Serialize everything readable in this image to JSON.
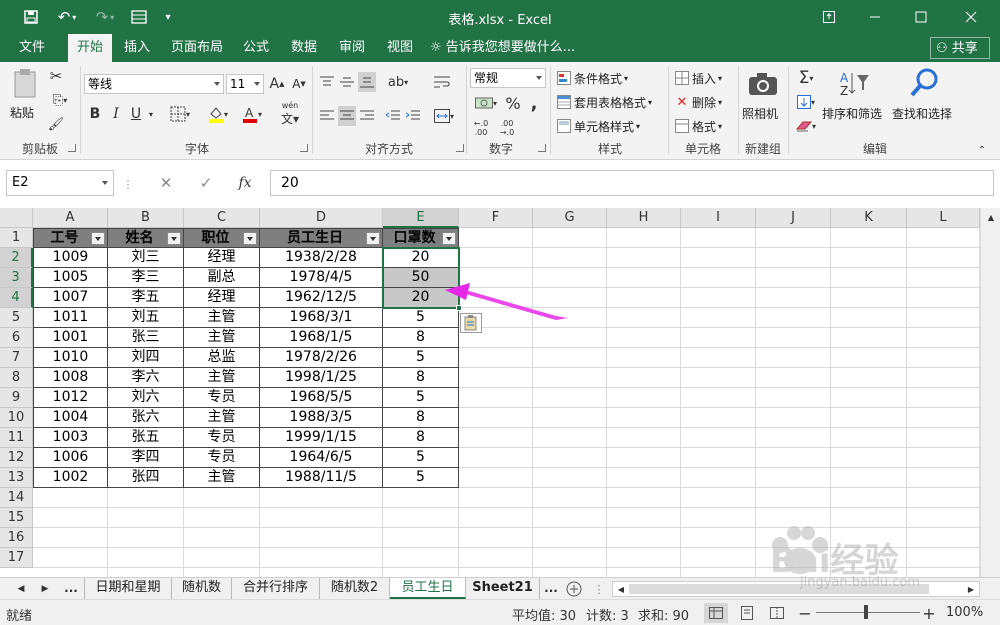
{
  "app": {
    "title": "表格.xlsx - Excel"
  },
  "menu": {
    "tabs": [
      "文件",
      "开始",
      "插入",
      "页面布局",
      "公式",
      "数据",
      "审阅",
      "视图"
    ],
    "tell_me": "告诉我您想要做什么...",
    "share": "共享"
  },
  "ribbon": {
    "clipboard": {
      "paste": "粘贴",
      "label": "剪贴板"
    },
    "font": {
      "name": "等线",
      "size": "11",
      "label": "字体",
      "bold": "B",
      "italic": "I",
      "underline": "U",
      "phonetic": "wén"
    },
    "alignment": {
      "label": "对齐方式"
    },
    "number": {
      "format": "常规",
      "percent": "%",
      "comma": ",",
      "label": "数字",
      "inc_dec": ".00→.0",
      "dec_inc": ".00→.0"
    },
    "styles": {
      "conditional": "条件格式",
      "table": "套用表格格式",
      "cell": "单元格样式",
      "label": "样式"
    },
    "cells": {
      "insert": "插入",
      "delete": "删除",
      "format": "格式",
      "label": "单元格"
    },
    "new_group": {
      "camera": "照相机",
      "label": "新建组"
    },
    "editing": {
      "sort": "排序和筛选",
      "find": "查找和选择",
      "label": "编辑",
      "sigma": "Σ"
    }
  },
  "formula_bar": {
    "name_box": "E2",
    "fx": "fx",
    "value": "20"
  },
  "sheet": {
    "columns": [
      "A",
      "B",
      "C",
      "D",
      "E",
      "F",
      "G",
      "H",
      "I",
      "J",
      "K",
      "L"
    ],
    "rows": [
      "1",
      "2",
      "3",
      "4",
      "5",
      "6",
      "7",
      "8",
      "9",
      "10",
      "11",
      "12",
      "13",
      "14",
      "15",
      "16",
      "17"
    ],
    "headers": [
      "工号",
      "姓名",
      "职位",
      "员工生日",
      "口罩数"
    ],
    "data": [
      [
        "1009",
        "刘三",
        "经理",
        "1938/2/28",
        "20"
      ],
      [
        "1005",
        "李三",
        "副总",
        "1978/4/5",
        "50"
      ],
      [
        "1007",
        "李五",
        "经理",
        "1962/12/5",
        "20"
      ],
      [
        "1011",
        "刘五",
        "主管",
        "1968/3/1",
        "5"
      ],
      [
        "1001",
        "张三",
        "主管",
        "1968/1/5",
        "8"
      ],
      [
        "1010",
        "刘四",
        "总监",
        "1978/2/26",
        "5"
      ],
      [
        "1008",
        "李六",
        "主管",
        "1998/1/25",
        "8"
      ],
      [
        "1012",
        "刘六",
        "专员",
        "1968/5/5",
        "5"
      ],
      [
        "1004",
        "张六",
        "主管",
        "1988/3/5",
        "8"
      ],
      [
        "1003",
        "张五",
        "专员",
        "1999/1/15",
        "8"
      ],
      [
        "1006",
        "李四",
        "专员",
        "1964/6/5",
        "5"
      ],
      [
        "1002",
        "张四",
        "主管",
        "1988/11/5",
        "5"
      ]
    ]
  },
  "sheet_tabs": {
    "tabs": [
      "日期和星期",
      "随机数",
      "合并行排序",
      "随机数2",
      "员工生日",
      "Sheet21"
    ],
    "active": "员工生日",
    "more": "...",
    "more_right": "..."
  },
  "status": {
    "ready": "就绪",
    "average": "平均值: 30",
    "count": "计数: 3",
    "sum": "求和: 90",
    "zoom": "100%"
  },
  "watermark": {
    "line1": "Bai经验",
    "line2": "jingyan.baidu.com"
  },
  "colors": {
    "excel_green": "#217346",
    "arrow": "#e628e6"
  }
}
